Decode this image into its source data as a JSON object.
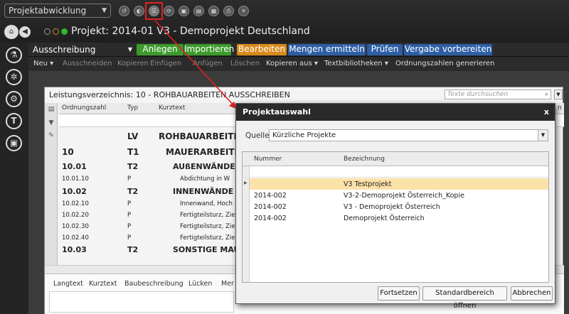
{
  "module": {
    "label": "Projektabwicklung"
  },
  "quick_icons": [
    "save-icon",
    "undo-icon",
    "list-icon",
    "refresh-icon",
    "copy-icon",
    "paste-icon",
    "grid-icon",
    "print-icon",
    "close-icon"
  ],
  "project": {
    "title": "Projekt: 2014-01 V3 - Demoprojekt Deutschland"
  },
  "ribbon": {
    "dropdown": "Ausschreibung",
    "tabs": [
      {
        "label": "Anlegen",
        "color": "#3c9a2c"
      },
      {
        "label": "Importieren",
        "color": "#3c9a2c"
      },
      {
        "label": "Bearbeiten",
        "color": "#d88a1c"
      },
      {
        "label": "Mengen ermitteln",
        "color": "#2e5fa5"
      },
      {
        "label": "Prüfen",
        "color": "#2e5fa5"
      },
      {
        "label": "Vergabe vorbereiten",
        "color": "#2e5fa5"
      }
    ],
    "menu": [
      "Neu ▾",
      "Ausschneiden",
      "Kopieren",
      "Einfügen",
      "Anfügen",
      "Löschen",
      "Kopieren aus ▾",
      "Textbibliotheken ▾",
      "Ordnungszahlen generieren"
    ]
  },
  "lv": {
    "title": "Leistungsverzeichnis: 10 - ROHBAUARBEITEN AUSSCHREIBEN",
    "search_placeholder": "Texte durchsuchen",
    "columns": {
      "oz": "Ordnungszahl",
      "typ": "Typ",
      "kurz": "Kurztext",
      "right": "n"
    },
    "rows": [
      {
        "oz": "",
        "typ": "LV",
        "kurz": "ROHBAUARBEITE"
      },
      {
        "oz": "10",
        "typ": "T1",
        "kurz": "MAUERARBEITE"
      },
      {
        "oz": "10.01",
        "typ": "T2",
        "kurz": "AUßENWÄNDE"
      },
      {
        "oz": "10.01.10",
        "typ": "P",
        "kurz": "Abdichtung in W"
      },
      {
        "oz": "10.02",
        "typ": "T2",
        "kurz": "INNENWÄNDE"
      },
      {
        "oz": "10.02.10",
        "typ": "P",
        "kurz": "Innenwand, Hoch"
      },
      {
        "oz": "10.02.20",
        "typ": "P",
        "kurz": "Fertigteilsturz, Zie"
      },
      {
        "oz": "10.02.30",
        "typ": "P",
        "kurz": "Fertigteilsturz, Zie"
      },
      {
        "oz": "10.02.40",
        "typ": "P",
        "kurz": "Fertigteilsturz, Zie"
      },
      {
        "oz": "10.03",
        "typ": "T2",
        "kurz": "SONSTIGE MAU"
      }
    ],
    "bottom_tabs": [
      "Langtext",
      "Kurztext",
      "Baubeschreibung",
      "Lücken",
      "Mer"
    ]
  },
  "dialog": {
    "title": "Projektauswahl",
    "close": "x",
    "source_label": "Quelle",
    "source_value": "Kürzliche Projekte",
    "columns": {
      "nummer": "Nummer",
      "bezeichnung": "Bezeichnung"
    },
    "rows": [
      {
        "nummer": "",
        "bezeichnung": "V3 Testprojekt"
      },
      {
        "nummer": "2014-002",
        "bezeichnung": "V3-2-Demoprojekt Österreich_Kopie"
      },
      {
        "nummer": "2014-002",
        "bezeichnung": "V3 - Demoprojekt Österreich"
      },
      {
        "nummer": "2014-002",
        "bezeichnung": "Demoprojekt Österreich"
      }
    ],
    "buttons": {
      "continue": "Fortsetzen",
      "default": "Standardbereich öffnen",
      "cancel": "Abbrechen"
    }
  },
  "colors": {
    "highlight": "#e02020",
    "selected_row": "#fbe2a8"
  }
}
